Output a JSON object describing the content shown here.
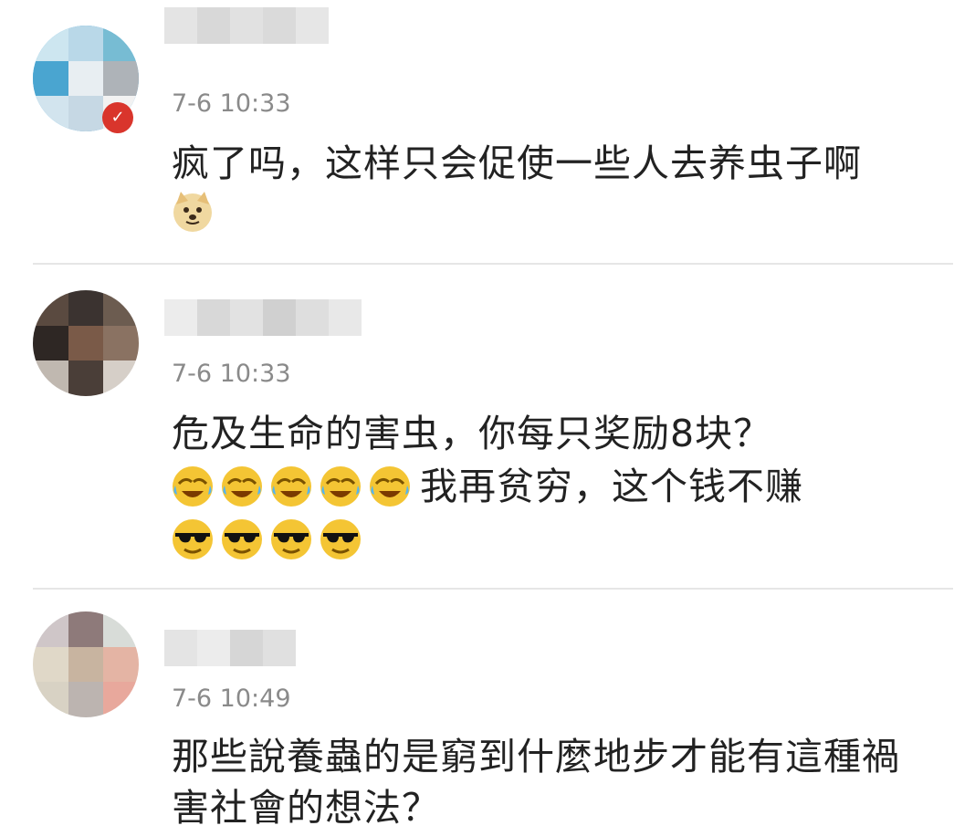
{
  "comments": [
    {
      "time": "7-6 10:33",
      "lines": [
        "疯了吗，这样只会促使一些人去养虫子啊"
      ],
      "emojis": [
        "doge-icon"
      ]
    },
    {
      "time": "7-6 10:33",
      "lines": [
        "危及生命的害虫，你每只奖励8块？",
        "我再贫穷，这个钱不赚"
      ],
      "emojis_before_line2": [
        "laugh-cry-icon",
        "laugh-cry-icon",
        "laugh-cry-icon",
        "laugh-cry-icon",
        "laugh-cry-icon"
      ],
      "emojis_after": [
        "sunglasses-icon",
        "sunglasses-icon",
        "sunglasses-icon",
        "sunglasses-icon"
      ]
    },
    {
      "time": "7-6 10:49",
      "lines": [
        "那些說養蟲的是窮到什麼地步才能有這種禍",
        "害社會的想法？"
      ]
    }
  ],
  "colors": {
    "time": "#8a8a8a",
    "text": "#222222",
    "divider": "#e6e6e6",
    "emoji_yellow": "#f4c534"
  }
}
